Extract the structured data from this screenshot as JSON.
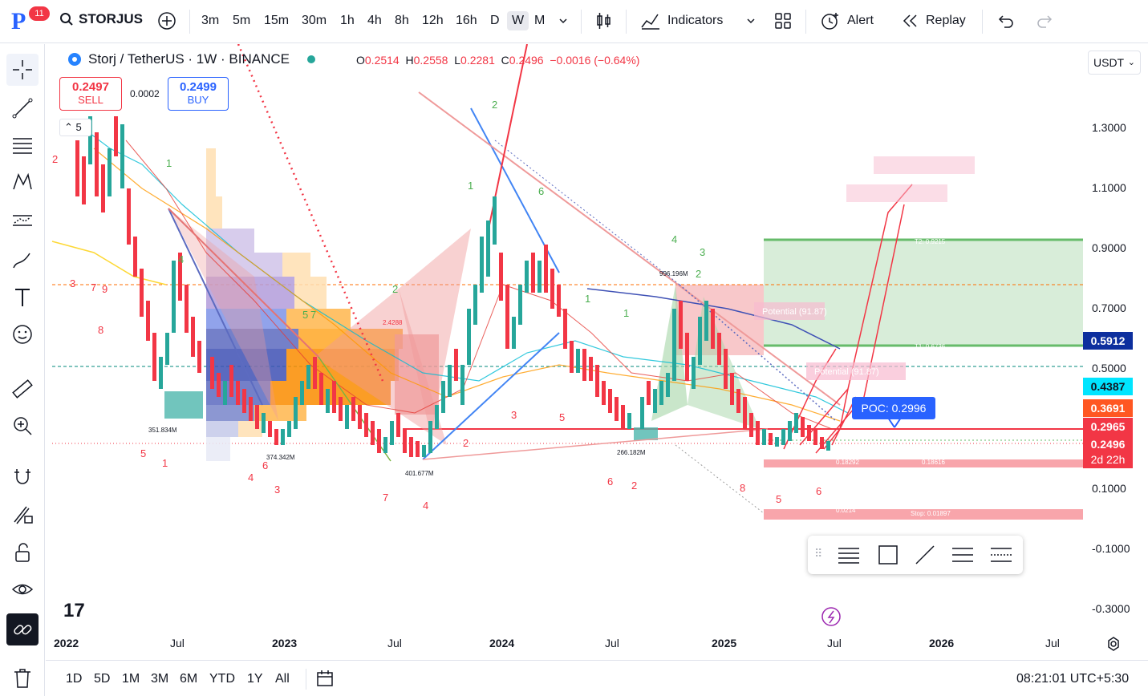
{
  "header": {
    "notification_count": "11",
    "symbol": "STORJUS",
    "intervals": [
      "3m",
      "5m",
      "15m",
      "30m",
      "1h",
      "4h",
      "8h",
      "12h",
      "16h",
      "D",
      "W",
      "M"
    ],
    "active_interval": "W",
    "indicators_label": "Indicators",
    "alert_label": "Alert",
    "replay_label": "Replay"
  },
  "legend": {
    "title": "Storj / TetherUS · 1W · BINANCE",
    "open_label": "O",
    "open": "0.2514",
    "high_label": "H",
    "high": "0.2558",
    "low_label": "L",
    "low": "0.2281",
    "close_label": "C",
    "close": "0.2496",
    "change": "−0.0016 (−0.64%)"
  },
  "trade": {
    "sell_price": "0.2497",
    "sell_label": "SELL",
    "buy_price": "0.2499",
    "buy_label": "BUY",
    "spread": "0.0002"
  },
  "collapse_count": "5",
  "currency": "USDT",
  "y_axis": [
    "1.3000",
    "1.1000",
    "0.9000",
    "0.7000",
    "0.5000",
    "0.1000",
    "-0.1000",
    "-0.3000"
  ],
  "price_tags": [
    {
      "value": "0.5912",
      "color": "#0d2f9e"
    },
    {
      "value": "0.4387",
      "color": "#00e5ff",
      "text_color": "#131722"
    },
    {
      "value": "0.3691",
      "color": "#ff5722"
    },
    {
      "value": "0.2965",
      "color": "#f23645"
    },
    {
      "value": "0.2496",
      "color": "#f23645"
    },
    {
      "value": "2d 22h",
      "color": "#f23645"
    }
  ],
  "poc_label": "POC: 0.2996",
  "x_axis": [
    "2022",
    "Jul",
    "2023",
    "Jul",
    "2024",
    "Jul",
    "2025",
    "Jul",
    "2026",
    "Jul"
  ],
  "ranges": [
    "1D",
    "5D",
    "1M",
    "3M",
    "6M",
    "YTD",
    "1Y",
    "All"
  ],
  "clock": "08:21:01 UTC+5:30",
  "chart_annotations": {
    "vol_labels": [
      "351.834M",
      "374.342M",
      "401.677M",
      "266.182M",
      "996.196M"
    ],
    "potential_labels": [
      "Potential (91.87)",
      "Potential (91.87)"
    ],
    "stop_label": "Stop: 0.01897",
    "target_labels": [
      "T2: 0.9215",
      "T1: 0.6736"
    ],
    "small_values": [
      "2.4288",
      "0.0214",
      "0.18292",
      "0.18616"
    ]
  },
  "colors": {
    "bull": "#26a69a",
    "bear": "#f23645",
    "accent": "#2962ff"
  }
}
